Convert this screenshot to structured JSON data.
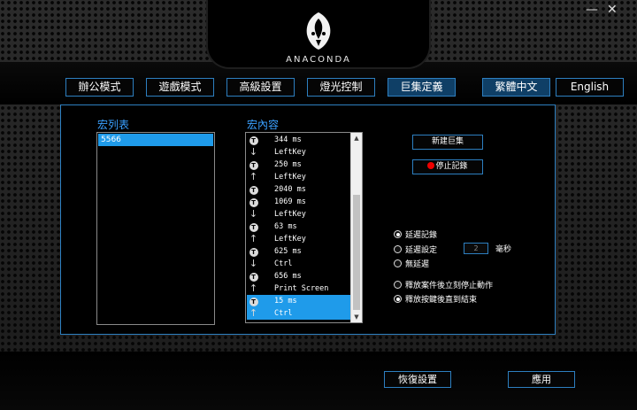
{
  "brand": {
    "name": "ANACONDA"
  },
  "window": {
    "minimize_icon": "minimize-icon",
    "close_icon": "close-icon",
    "minimize_label": "—",
    "close_label": "✕"
  },
  "tabs": [
    {
      "label": "辦公模式",
      "active": false
    },
    {
      "label": "遊戲模式",
      "active": false
    },
    {
      "label": "高級設置",
      "active": false
    },
    {
      "label": "燈光控制",
      "active": false
    },
    {
      "label": "巨集定義",
      "active": true
    }
  ],
  "languages": [
    {
      "label": "繁體中文",
      "active": true
    },
    {
      "label": "English",
      "active": false
    }
  ],
  "macro_list": {
    "title": "宏列表",
    "items": [
      "5566"
    ]
  },
  "macro_content": {
    "title": "宏內容",
    "rows": [
      {
        "icon": "timer-icon",
        "text": "344 ms"
      },
      {
        "icon": "key-down-icon",
        "text": "LeftKey"
      },
      {
        "icon": "timer-icon",
        "text": "250 ms"
      },
      {
        "icon": "key-up-icon",
        "text": "LeftKey"
      },
      {
        "icon": "timer-icon",
        "text": "2040 ms"
      },
      {
        "icon": "timer-icon",
        "text": "1069 ms"
      },
      {
        "icon": "key-down-icon",
        "text": "LeftKey"
      },
      {
        "icon": "timer-icon",
        "text": "63 ms"
      },
      {
        "icon": "key-up-icon",
        "text": "LeftKey"
      },
      {
        "icon": "timer-icon",
        "text": "625 ms"
      },
      {
        "icon": "key-down-icon",
        "text": "Ctrl"
      },
      {
        "icon": "timer-icon",
        "text": "656 ms"
      },
      {
        "icon": "key-up-icon",
        "text": "Print Screen"
      },
      {
        "icon": "timer-icon",
        "text": "15 ms",
        "selected": true
      },
      {
        "icon": "key-up-icon",
        "text": "Ctrl",
        "selected": true
      }
    ],
    "timer_glyph": "T"
  },
  "actions": {
    "new_macro": "新建巨集",
    "stop_record": "停止記錄"
  },
  "delay_options": [
    {
      "label": "延遲記錄",
      "checked": true
    },
    {
      "label": "延遲設定",
      "checked": false
    },
    {
      "label": "無延遲",
      "checked": false
    }
  ],
  "delay_value": "2",
  "delay_unit": "毫秒",
  "release_options": [
    {
      "label": "釋放案件後立刻停止動作",
      "checked": false
    },
    {
      "label": "釋放按鍵後直到結束",
      "checked": true
    }
  ],
  "footer": {
    "restore": "恢復設置",
    "apply": "應用"
  },
  "colors": {
    "accent": "#2d7fc0",
    "selection": "#1f9bea",
    "label_blue": "#3aa0ff",
    "record": "#ee0000"
  }
}
